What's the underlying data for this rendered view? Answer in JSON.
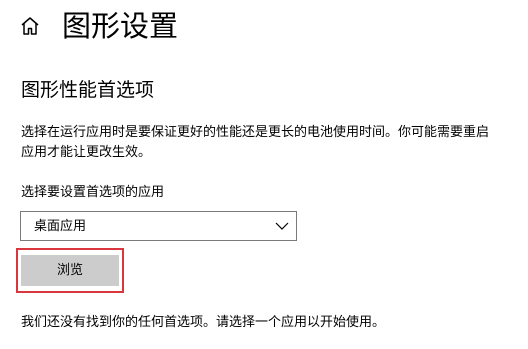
{
  "header": {
    "home_icon": "home-icon",
    "title": "图形设置"
  },
  "section": {
    "heading": "图形性能首选项",
    "description": "选择在运行应用时是要保证更好的性能还是更长的电池使用时间。你可能需要重启应用才能让更改生效。"
  },
  "app_selector": {
    "label": "选择要设置首选项的应用",
    "selected_value": "桌面应用",
    "chevron_icon": "chevron-down-icon"
  },
  "browse": {
    "label": "浏览",
    "highlight_color": "#d9363e"
  },
  "info_text": "我们还没有找到你的任何首选项。请选择一个应用以开始使用。"
}
